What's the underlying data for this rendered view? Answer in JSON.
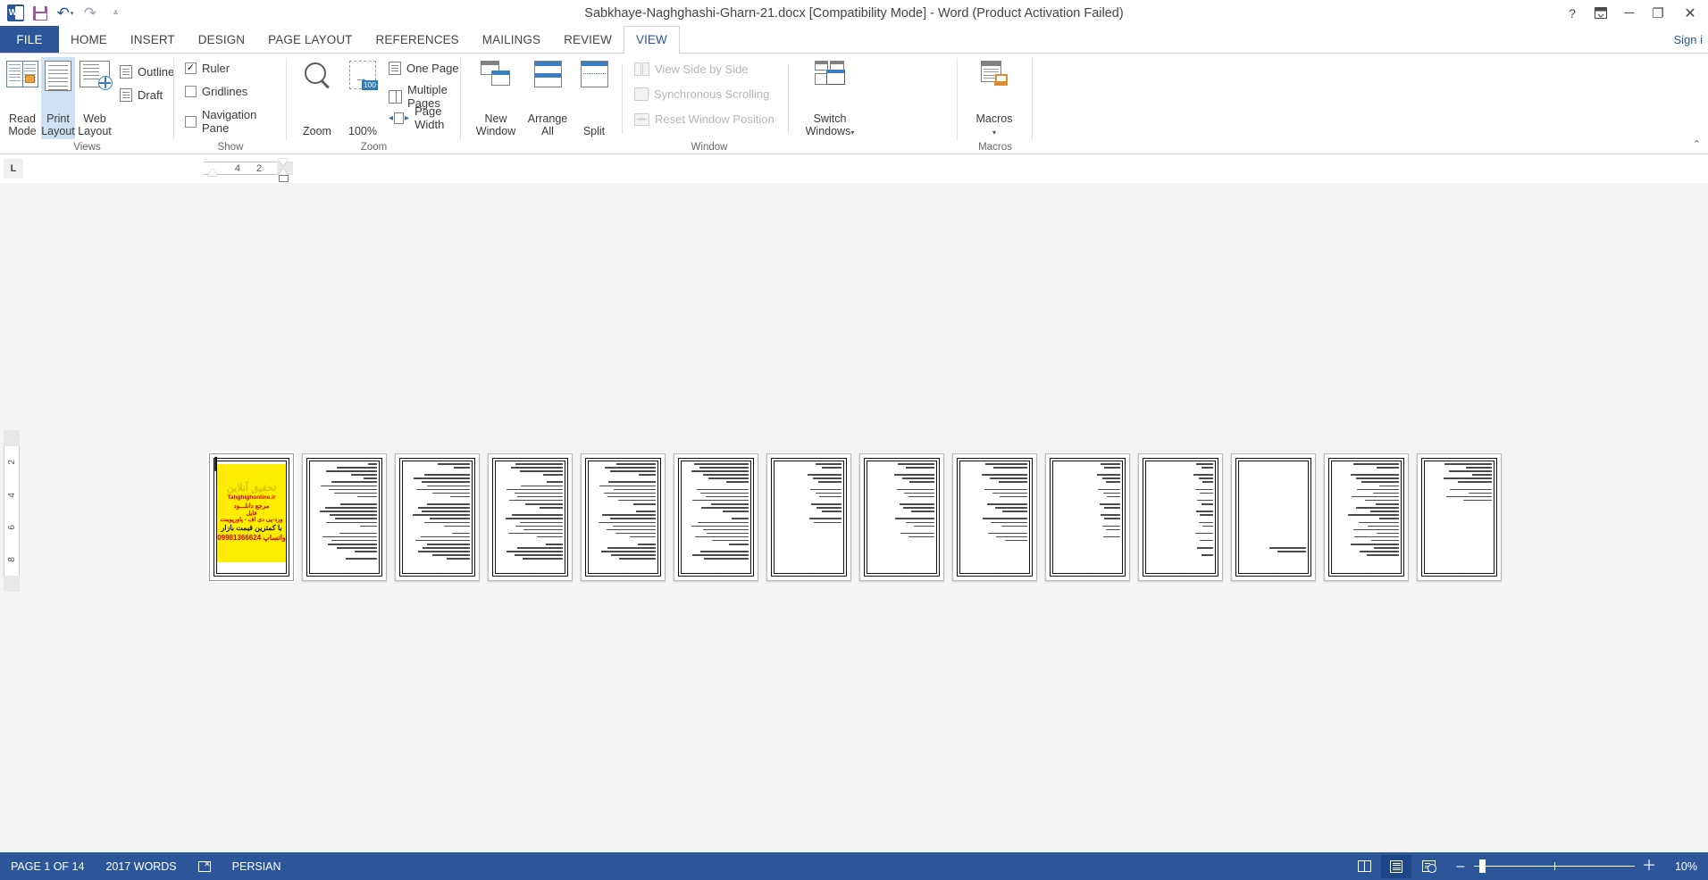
{
  "window": {
    "title": "Sabkhaye-Naghghashi-Gharn-21.docx [Compatibility Mode] - Word (Product Activation Failed)",
    "help_icon": "?",
    "ribbon_display_icon": "ribbon-display-options",
    "minimize_icon": "─",
    "restore_icon": "❐",
    "close_icon": "✕",
    "sign_in": "Sign i"
  },
  "quick_access": {
    "app_icon_letter": "W",
    "save_label": "Save",
    "undo_label": "Undo",
    "redo_label": "Redo",
    "customize_label": "Customize Quick Access Toolbar"
  },
  "tabs": [
    {
      "label": "FILE",
      "active": false,
      "is_file": true
    },
    {
      "label": "HOME",
      "active": false
    },
    {
      "label": "INSERT",
      "active": false
    },
    {
      "label": "DESIGN",
      "active": false
    },
    {
      "label": "PAGE LAYOUT",
      "active": false
    },
    {
      "label": "REFERENCES",
      "active": false
    },
    {
      "label": "MAILINGS",
      "active": false
    },
    {
      "label": "REVIEW",
      "active": false
    },
    {
      "label": "VIEW",
      "active": true
    }
  ],
  "ribbon": {
    "groups": [
      {
        "name": "Views",
        "label": "Views"
      },
      {
        "name": "Show",
        "label": "Show"
      },
      {
        "name": "Zoom",
        "label": "Zoom"
      },
      {
        "name": "Window",
        "label": "Window"
      },
      {
        "name": "Macros",
        "label": "Macros"
      }
    ],
    "views": {
      "read_mode": {
        "line1": "Read",
        "line2": "Mode",
        "selected": false
      },
      "print_layout": {
        "line1": "Print",
        "line2": "Layout",
        "selected": true
      },
      "web_layout": {
        "line1": "Web",
        "line2": "Layout",
        "selected": false
      },
      "outline": "Outline",
      "draft": "Draft"
    },
    "show": {
      "ruler": {
        "label": "Ruler",
        "checked": true,
        "check_glyph": "✓"
      },
      "gridlines": {
        "label": "Gridlines",
        "checked": false,
        "check_glyph": ""
      },
      "navigation_pane": {
        "label": "Navigation Pane",
        "checked": false,
        "check_glyph": ""
      }
    },
    "zoom": {
      "zoom_button": "Zoom",
      "one_hundred_button": "100%",
      "badge": "100",
      "one_page": "One Page",
      "multiple_pages": "Multiple Pages",
      "page_width": "Page Width"
    },
    "window": {
      "new_window": {
        "line1": "New",
        "line2": "Window"
      },
      "arrange_all": {
        "line1": "Arrange",
        "line2": "All"
      },
      "split": {
        "line1": "Split",
        "line2": ""
      },
      "view_side_by_side": {
        "label": "View Side by Side",
        "disabled": true
      },
      "synchronous_scrolling": {
        "label": "Synchronous Scrolling",
        "disabled": true
      },
      "reset_window_position": {
        "label": "Reset Window Position",
        "disabled": true
      },
      "switch_windows": {
        "line1": "Switch",
        "line2": "Windows"
      }
    },
    "macros": {
      "label": "Macros",
      "caret": "▾"
    },
    "collapse_icon": "⌃"
  },
  "ruler": {
    "tab_selector": "L",
    "h_marks": [
      "4",
      "2"
    ],
    "v_marks": [
      "2",
      "4",
      "6",
      "8"
    ]
  },
  "document": {
    "page_count": 14,
    "pages": [
      {
        "index": 1,
        "current": true,
        "has_ad": true,
        "ad": {
          "headline": "تحقیق آنلاین",
          "site": "Tahghighonline.ir",
          "line_source": "مرجع دانلـــود",
          "line_file": "فایل",
          "line_formats": "ورد-پی دی اف - پاورپوینت",
          "line_price": "با کمترین قیمت بازار",
          "line_phone": "09981366624 واتساپ"
        },
        "lines": []
      },
      {
        "index": 2,
        "current": false,
        "has_ad": false,
        "lines": [
          14,
          62,
          78,
          40,
          20,
          70,
          86,
          74,
          66,
          30,
          0,
          56,
          80,
          88,
          72,
          64,
          78,
          26,
          0,
          58,
          84,
          70,
          76,
          62,
          34,
          0,
          48
        ]
      },
      {
        "index": 3,
        "current": false,
        "has_ad": false,
        "lines": [
          50,
          24,
          0,
          70,
          86,
          74,
          66,
          82,
          58,
          30,
          0,
          66,
          80,
          74,
          88,
          62,
          70,
          40,
          0,
          28,
          76,
          84,
          66,
          72,
          80,
          58,
          36
        ]
      },
      {
        "index": 4,
        "current": false,
        "has_ad": false,
        "lines": [
          72,
          80,
          66,
          30,
          0,
          24,
          64,
          86,
          74,
          70,
          82,
          58,
          36,
          0,
          78,
          88,
          66,
          72,
          60,
          84,
          40,
          0,
          26,
          70,
          86,
          74,
          62
        ]
      },
      {
        "index": 5,
        "current": false,
        "has_ad": false,
        "lines": [
          60,
          78,
          70,
          26,
          0,
          72,
          86,
          64,
          80,
          74,
          58,
          34,
          0,
          30,
          82,
          70,
          88,
          66,
          76,
          62,
          40,
          0,
          28,
          74,
          84,
          68,
          56
        ]
      },
      {
        "index": 6,
        "current": false,
        "has_ad": false,
        "lines": [
          84,
          76,
          88,
          70,
          62,
          34,
          0,
          80,
          74,
          66,
          86,
          58,
          72,
          40,
          0,
          26,
          78,
          88,
          70,
          64,
          82,
          56,
          30,
          0,
          74,
          86,
          68
        ]
      },
      {
        "index": 7,
        "current": false,
        "has_ad": false,
        "lines": [
          40,
          30,
          0,
          52,
          44,
          36,
          0,
          48,
          40,
          34,
          0,
          46,
          38,
          30,
          0,
          50,
          42,
          0,
          0,
          0,
          0,
          0,
          0,
          0,
          0,
          0,
          0
        ]
      },
      {
        "index": 8,
        "current": false,
        "has_ad": false,
        "lines": [
          56,
          44,
          0,
          62,
          50,
          38,
          0,
          58,
          46,
          40,
          0,
          54,
          48,
          36,
          0,
          60,
          44,
          32,
          0,
          52,
          40,
          0,
          0,
          0,
          0,
          0,
          0
        ]
      },
      {
        "index": 9,
        "current": false,
        "has_ad": false,
        "lines": [
          64,
          52,
          0,
          70,
          58,
          44,
          0,
          66,
          54,
          42,
          0,
          62,
          50,
          38,
          0,
          68,
          56,
          40,
          0,
          60,
          48,
          34,
          0,
          0,
          0,
          0,
          0
        ]
      },
      {
        "index": 10,
        "current": false,
        "has_ad": false,
        "lines": [
          30,
          24,
          0,
          36,
          28,
          22,
          0,
          34,
          26,
          20,
          0,
          32,
          25,
          0,
          30,
          24,
          0,
          28,
          22,
          0,
          26,
          0,
          0,
          0,
          0,
          0,
          0
        ]
      },
      {
        "index": 11,
        "current": false,
        "has_ad": false,
        "lines": [
          26,
          18,
          0,
          30,
          22,
          16,
          0,
          28,
          20,
          0,
          24,
          18,
          0,
          26,
          20,
          0,
          22,
          16,
          0,
          28,
          0,
          20,
          0,
          24,
          0,
          18,
          0
        ]
      },
      {
        "index": 12,
        "current": false,
        "has_ad": false,
        "lines": [
          0,
          0,
          0,
          0,
          0,
          0,
          0,
          0,
          0,
          0,
          0,
          0,
          0,
          0,
          0,
          0,
          0,
          0,
          0,
          0,
          0,
          0,
          0,
          56,
          44,
          0,
          0
        ]
      },
      {
        "index": 13,
        "current": false,
        "has_ad": false,
        "lines": [
          70,
          34,
          0,
          74,
          66,
          58,
          30,
          64,
          40,
          72,
          52,
          36,
          66,
          44,
          78,
          30,
          62,
          48,
          70,
          34,
          68,
          42,
          74,
          38,
          60,
          50,
          0
        ]
      },
      {
        "index": 14,
        "current": false,
        "has_ad": false,
        "lines": [
          72,
          40,
          66,
          30,
          74,
          52,
          0,
          64,
          36,
          70,
          44,
          0,
          0,
          0,
          0,
          0,
          0,
          0,
          0,
          0,
          0,
          0,
          0,
          0,
          0,
          0,
          0
        ]
      }
    ]
  },
  "status_bar": {
    "page_indicator": "PAGE 1 OF 14",
    "word_count": "2017 WORDS",
    "proofing_icon": "proofing-errors-icon",
    "language": "PERSIAN",
    "views": {
      "read_mode": "read-mode-icon",
      "print_layout": "print-layout-icon",
      "web_layout": "web-layout-icon",
      "active": "print_layout"
    },
    "zoom": {
      "out_glyph": "–",
      "in_glyph": "＋",
      "value": "10%"
    }
  }
}
